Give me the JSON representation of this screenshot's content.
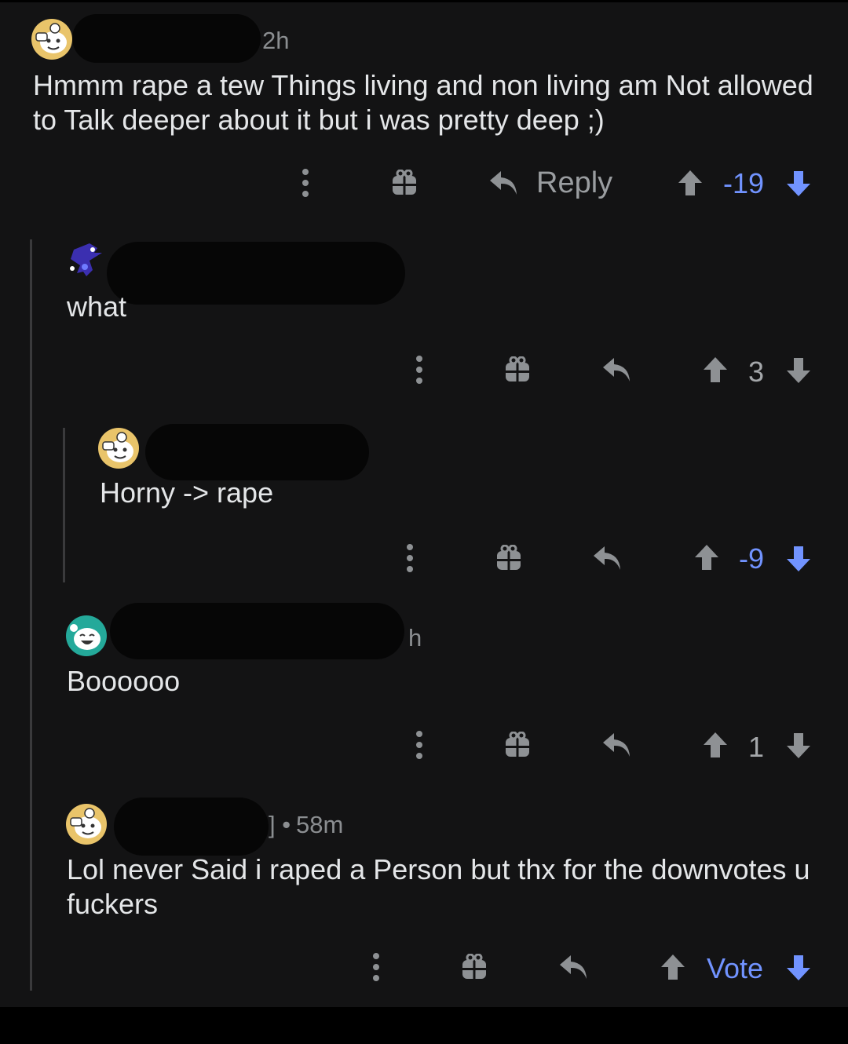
{
  "colors": {
    "background": "#131314",
    "text": "#e4e6e8",
    "muted": "#8b8e91",
    "vote_blue": "#7193ff",
    "icon_gray": "#8e9194",
    "thread_line": "#3a3a3c"
  },
  "comments": [
    {
      "time": "2h",
      "body": "Hmmm rape a tew Things living and non living am Not allowed to Talk deeper about it but i was pretty deep ;)",
      "reply_label": "Reply",
      "score": "-19",
      "vote_state": "downvoted"
    },
    {
      "body": "what",
      "score": "3",
      "vote_state": "none"
    },
    {
      "body": "Horny -> rape",
      "score": "-9",
      "vote_state": "downvoted"
    },
    {
      "time": "h",
      "body": "Boooooo",
      "score": "1",
      "vote_state": "none"
    },
    {
      "time_prefix": "] •",
      "time": "58m",
      "body": "Lol never Said i raped a Person but thx for the downvotes u fuckers",
      "score": "Vote",
      "vote_state": "downvoted"
    }
  ]
}
